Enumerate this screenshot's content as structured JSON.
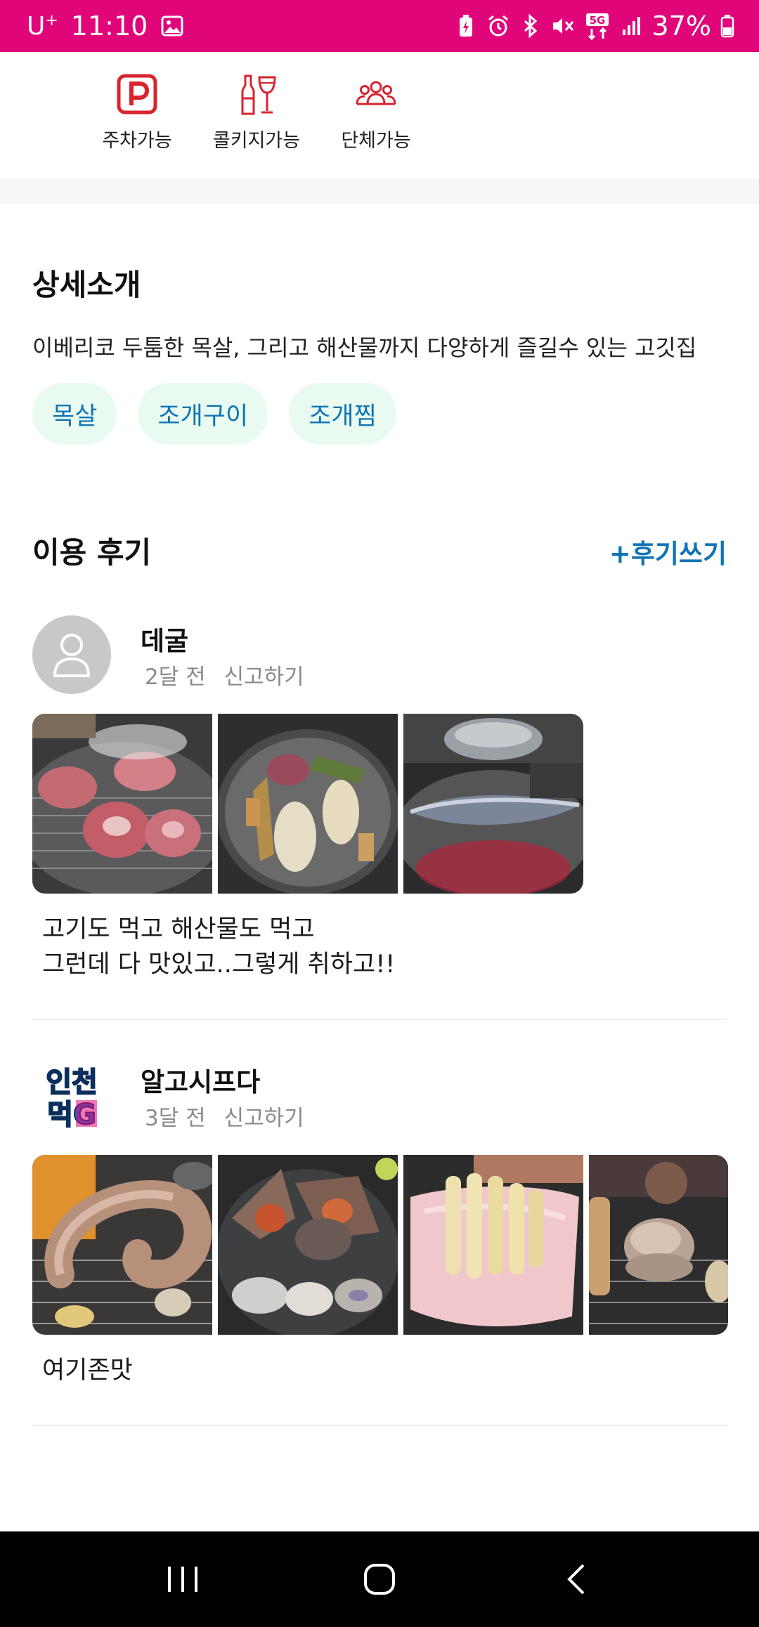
{
  "status_bar": {
    "carrier": "U",
    "carrier_sup": "+",
    "time": "11:10",
    "battery": "37%",
    "network": "5G"
  },
  "amenities": [
    {
      "label": "주차가능",
      "icon": "parking-icon"
    },
    {
      "label": "콜키지가능",
      "icon": "corkage-icon"
    },
    {
      "label": "단체가능",
      "icon": "group-icon"
    }
  ],
  "detail": {
    "title": "상세소개",
    "description": "이베리코 두툼한 목살, 그리고 해산물까지 다양하게 즐길수 있는 고깃집",
    "tags": [
      "목살",
      "조개구이",
      "조개찜"
    ]
  },
  "reviews_section": {
    "title": "이용 후기",
    "write_label": "+후기쓰기"
  },
  "reviews": [
    {
      "user": "데굴",
      "time": "2달 전",
      "report_label": "신고하기",
      "photos": [
        "pork-neck-grill-photo",
        "mixed-grill-photo",
        "mackerel-grill-photo"
      ],
      "text": "고기도 먹고 해산물도 먹고\n그런데 다 맛있고..그렇게  취하고!!"
    },
    {
      "user": "알고시프다",
      "time": "3달 전",
      "report_label": "신고하기",
      "avatar_logo_text": [
        "인천",
        "먹G"
      ],
      "photos": [
        "eel-grill-photo",
        "shellfish-platter-photo",
        "pork-rice-cake-photo",
        "clam-grill-photo"
      ],
      "text": "여기존맛"
    }
  ],
  "colors": {
    "status_bar": "#e0067a",
    "accent_blue": "#0f74b5",
    "tag_bg": "#e9fbf1",
    "amenity_red": "#d9232e"
  }
}
